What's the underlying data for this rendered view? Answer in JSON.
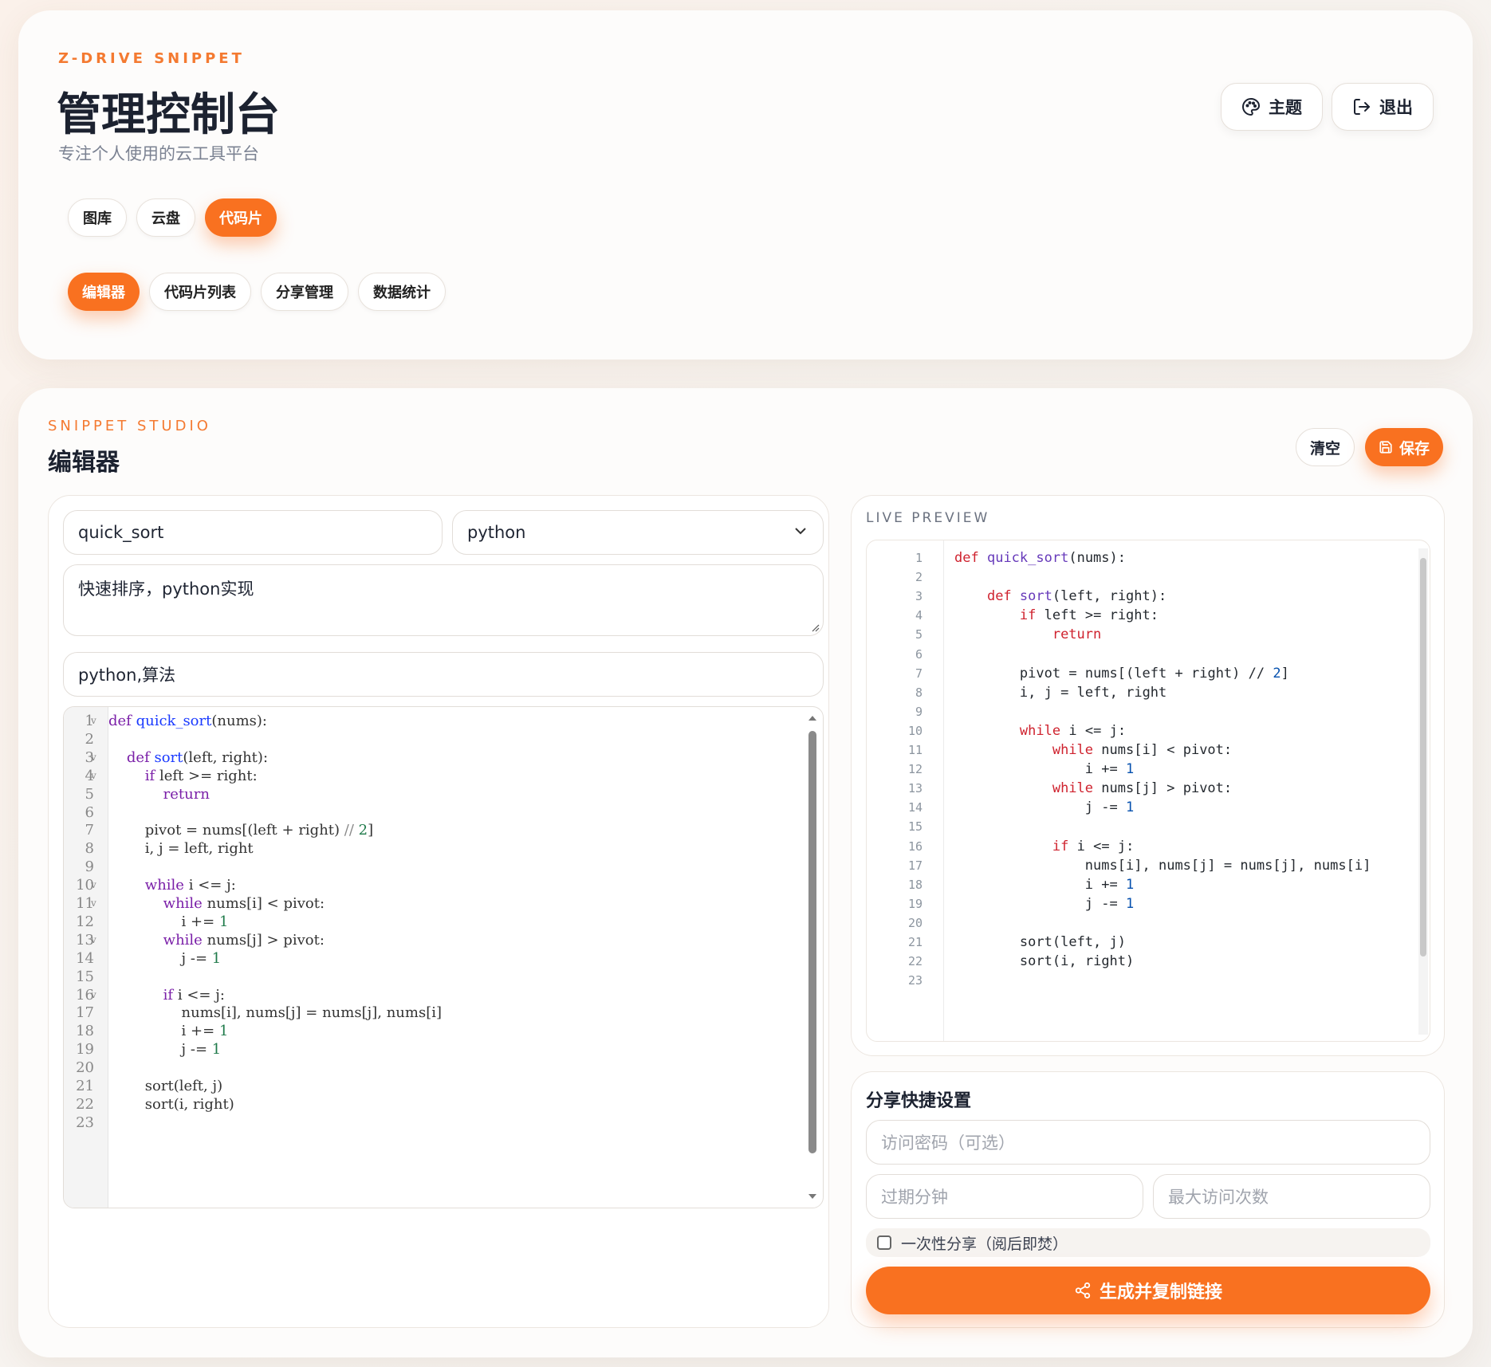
{
  "header": {
    "eyebrow": "Z-DRIVE SNIPPET",
    "title": "管理控制台",
    "subtitle": "专注个人使用的云工具平台",
    "theme_label": "主题",
    "logout_label": "退出"
  },
  "modules": [
    {
      "label": "图库",
      "active": false
    },
    {
      "label": "云盘",
      "active": false
    },
    {
      "label": "代码片",
      "active": true
    }
  ],
  "subtabs": [
    {
      "label": "编辑器",
      "active": true
    },
    {
      "label": "代码片列表",
      "active": false
    },
    {
      "label": "分享管理",
      "active": false
    },
    {
      "label": "数据统计",
      "active": false
    }
  ],
  "editor": {
    "eyebrow": "SNIPPET STUDIO",
    "title": "编辑器",
    "clear_label": "清空",
    "save_label": "保存",
    "name_value": "quick_sort",
    "language_value": "python",
    "description_value": "快速排序，python实现",
    "tags_value": "python,算法"
  },
  "code_lines": [
    "def quick_sort(nums):",
    "",
    "    def sort(left, right):",
    "        if left >= right:",
    "            return",
    "",
    "        pivot = nums[(left + right) // 2]",
    "        i, j = left, right",
    "",
    "        while i <= j:",
    "            while nums[i] < pivot:",
    "                i += 1",
    "            while nums[j] > pivot:",
    "                j -= 1",
    "",
    "            if i <= j:",
    "                nums[i], nums[j] = nums[j], nums[i]",
    "                i += 1",
    "                j -= 1",
    "",
    "        sort(left, j)",
    "        sort(i, right)",
    ""
  ],
  "fold_lines": [
    1,
    3,
    4,
    10,
    11,
    13,
    16
  ],
  "preview": {
    "eyebrow": "LIVE PREVIEW"
  },
  "share": {
    "title": "分享快捷设置",
    "password_placeholder": "访问密码（可选）",
    "expire_placeholder": "过期分钟",
    "max_visits_placeholder": "最大访问次数",
    "once_label": "一次性分享（阅后即焚）",
    "generate_label": "生成并复制链接"
  },
  "colors": {
    "accent": "#f97120",
    "background": "#f7f3ef"
  }
}
